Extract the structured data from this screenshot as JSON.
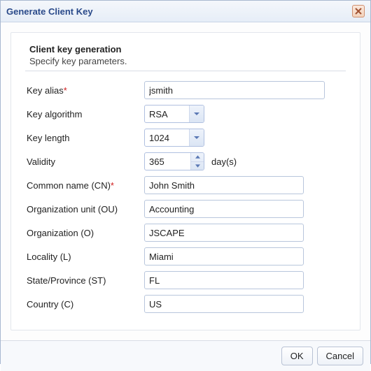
{
  "dialog": {
    "title": "Generate Client Key",
    "heading": "Client key generation",
    "subheading": "Specify key parameters."
  },
  "fields": {
    "key_alias": {
      "label": "Key alias",
      "required": true,
      "value": "jsmith"
    },
    "key_algorithm": {
      "label": "Key algorithm",
      "value": "RSA"
    },
    "key_length": {
      "label": "Key length",
      "value": "1024"
    },
    "validity": {
      "label": "Validity",
      "value": "365",
      "suffix": "day(s)"
    },
    "common_name": {
      "label": "Common name (CN)",
      "required": true,
      "value": "John Smith"
    },
    "org_unit": {
      "label": "Organization unit (OU)",
      "value": "Accounting"
    },
    "organization": {
      "label": "Organization (O)",
      "value": "JSCAPE"
    },
    "locality": {
      "label": "Locality (L)",
      "value": "Miami"
    },
    "state": {
      "label": "State/Province (ST)",
      "value": "FL"
    },
    "country": {
      "label": "Country (C)",
      "value": "US"
    }
  },
  "buttons": {
    "ok": "OK",
    "cancel": "Cancel"
  },
  "required_marker": "*"
}
